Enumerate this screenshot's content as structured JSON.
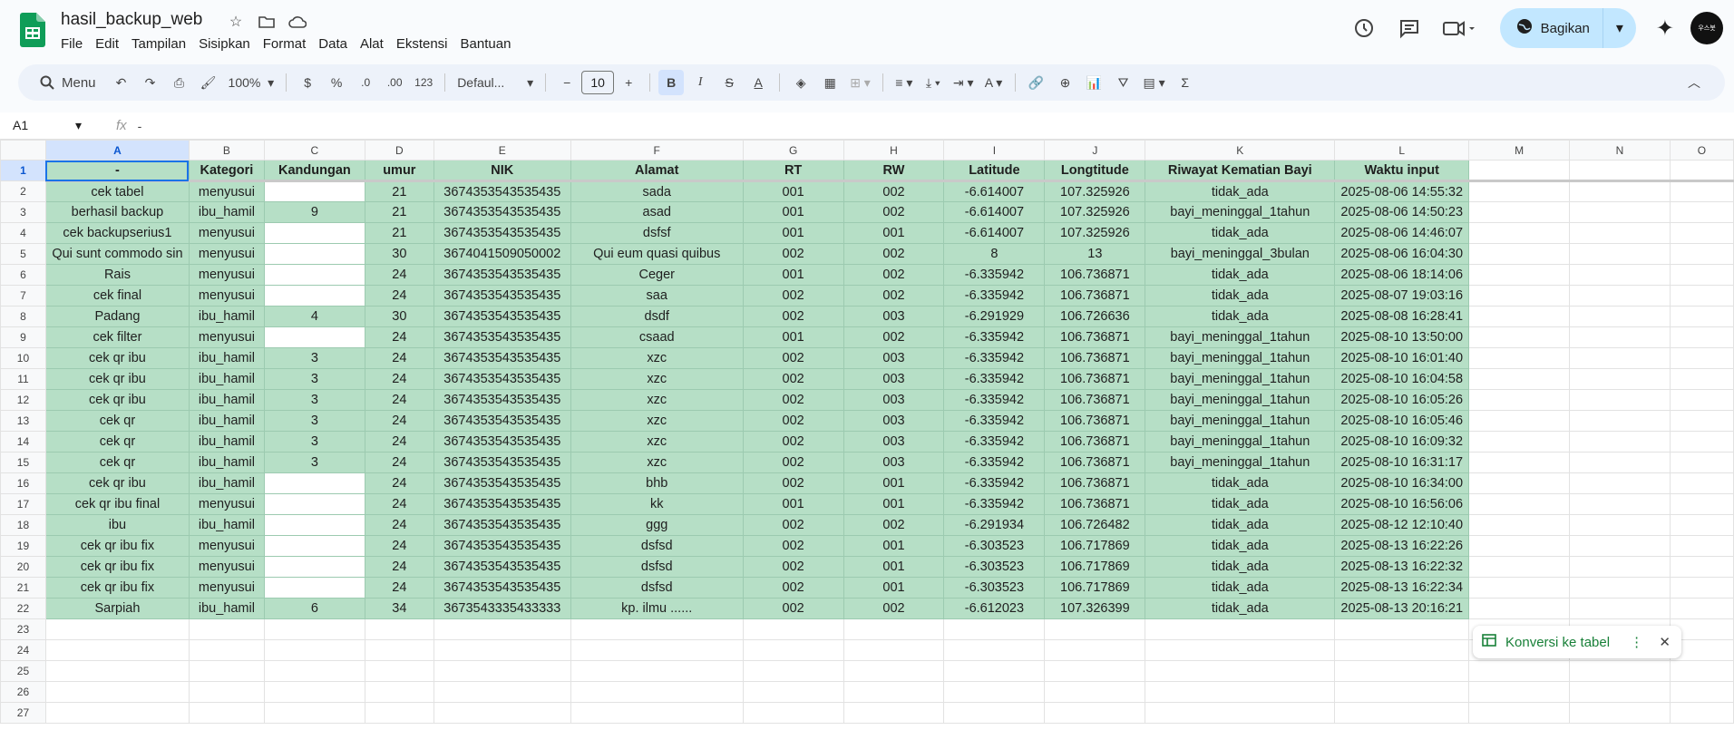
{
  "doc": {
    "title": "hasil_backup_web"
  },
  "menu": [
    "File",
    "Edit",
    "Tampilan",
    "Sisipkan",
    "Format",
    "Data",
    "Alat",
    "Ekstensi",
    "Bantuan"
  ],
  "share": {
    "label": "Bagikan"
  },
  "avatar": {
    "text": "우스봇"
  },
  "toolbar": {
    "menu_label": "Menu",
    "zoom": "100%",
    "currency": "$",
    "percent": "%",
    "dec_minus": ".0",
    "dec_plus": ".00",
    "num_format": "123",
    "font": "Defaul...",
    "font_size": "10"
  },
  "formula": {
    "cell_ref": "A1",
    "value": "-"
  },
  "columns": [
    "A",
    "B",
    "C",
    "D",
    "E",
    "F",
    "G",
    "H",
    "I",
    "J",
    "K",
    "L",
    "M",
    "N",
    "O"
  ],
  "header_row": [
    "-",
    "Kategori",
    "Kandungan",
    "umur",
    "NIK",
    "Alamat",
    "RT",
    "RW",
    "Latitude",
    "Longtitude",
    "Riwayat Kematian Bayi",
    "Waktu input"
  ],
  "rows": [
    [
      "cek tabel",
      "menyusui",
      "",
      "21",
      "3674353543535435",
      "sada",
      "001",
      "002",
      "-6.614007",
      "107.325926",
      "tidak_ada",
      "2025-08-06 14:55:32"
    ],
    [
      "berhasil backup",
      "ibu_hamil",
      "9",
      "21",
      "3674353543535435",
      "asad",
      "001",
      "002",
      "-6.614007",
      "107.325926",
      "bayi_meninggal_1tahun",
      "2025-08-06 14:50:23"
    ],
    [
      "cek backupserius1",
      "menyusui",
      "",
      "21",
      "3674353543535435",
      "dsfsf",
      "001",
      "001",
      "-6.614007",
      "107.325926",
      "tidak_ada",
      "2025-08-06 14:46:07"
    ],
    [
      "Qui sunt commodo sin",
      "menyusui",
      "",
      "30",
      "3674041509050002",
      "Qui eum quasi quibus",
      "002",
      "002",
      "8",
      "13",
      "bayi_meninggal_3bulan",
      "2025-08-06 16:04:30"
    ],
    [
      "Rais",
      "menyusui",
      "",
      "24",
      "3674353543535435",
      "Ceger",
      "001",
      "002",
      "-6.335942",
      "106.736871",
      "tidak_ada",
      "2025-08-06 18:14:06"
    ],
    [
      "cek final",
      "menyusui",
      "",
      "24",
      "3674353543535435",
      "saa",
      "002",
      "002",
      "-6.335942",
      "106.736871",
      "tidak_ada",
      "2025-08-07 19:03:16"
    ],
    [
      "Padang",
      "ibu_hamil",
      "4",
      "30",
      "3674353543535435",
      "dsdf",
      "002",
      "003",
      "-6.291929",
      "106.726636",
      "tidak_ada",
      "2025-08-08 16:28:41"
    ],
    [
      "cek filter",
      "menyusui",
      "",
      "24",
      "3674353543535435",
      "csaad",
      "001",
      "002",
      "-6.335942",
      "106.736871",
      "bayi_meninggal_1tahun",
      "2025-08-10 13:50:00"
    ],
    [
      "cek qr ibu",
      "ibu_hamil",
      "3",
      "24",
      "3674353543535435",
      "xzc",
      "002",
      "003",
      "-6.335942",
      "106.736871",
      "bayi_meninggal_1tahun",
      "2025-08-10 16:01:40"
    ],
    [
      "cek qr ibu",
      "ibu_hamil",
      "3",
      "24",
      "3674353543535435",
      "xzc",
      "002",
      "003",
      "-6.335942",
      "106.736871",
      "bayi_meninggal_1tahun",
      "2025-08-10 16:04:58"
    ],
    [
      "cek qr ibu",
      "ibu_hamil",
      "3",
      "24",
      "3674353543535435",
      "xzc",
      "002",
      "003",
      "-6.335942",
      "106.736871",
      "bayi_meninggal_1tahun",
      "2025-08-10 16:05:26"
    ],
    [
      "cek qr",
      "ibu_hamil",
      "3",
      "24",
      "3674353543535435",
      "xzc",
      "002",
      "003",
      "-6.335942",
      "106.736871",
      "bayi_meninggal_1tahun",
      "2025-08-10 16:05:46"
    ],
    [
      "cek qr",
      "ibu_hamil",
      "3",
      "24",
      "3674353543535435",
      "xzc",
      "002",
      "003",
      "-6.335942",
      "106.736871",
      "bayi_meninggal_1tahun",
      "2025-08-10 16:09:32"
    ],
    [
      "cek qr",
      "ibu_hamil",
      "3",
      "24",
      "3674353543535435",
      "xzc",
      "002",
      "003",
      "-6.335942",
      "106.736871",
      "bayi_meninggal_1tahun",
      "2025-08-10 16:31:17"
    ],
    [
      "cek qr ibu",
      "ibu_hamil",
      "",
      "24",
      "3674353543535435",
      "bhb",
      "002",
      "001",
      "-6.335942",
      "106.736871",
      "tidak_ada",
      "2025-08-10 16:34:00"
    ],
    [
      "cek qr ibu final",
      "menyusui",
      "",
      "24",
      "3674353543535435",
      "kk",
      "001",
      "001",
      "-6.335942",
      "106.736871",
      "tidak_ada",
      "2025-08-10 16:56:06"
    ],
    [
      "ibu",
      "ibu_hamil",
      "",
      "24",
      "3674353543535435",
      "ggg",
      "002",
      "002",
      "-6.291934",
      "106.726482",
      "tidak_ada",
      "2025-08-12 12:10:40"
    ],
    [
      "cek qr ibu fix",
      "menyusui",
      "",
      "24",
      "3674353543535435",
      "dsfsd",
      "002",
      "001",
      "-6.303523",
      "106.717869",
      "tidak_ada",
      "2025-08-13 16:22:26"
    ],
    [
      "cek qr ibu fix",
      "menyusui",
      "",
      "24",
      "3674353543535435",
      "dsfsd",
      "002",
      "001",
      "-6.303523",
      "106.717869",
      "tidak_ada",
      "2025-08-13 16:22:32"
    ],
    [
      "cek qr ibu fix",
      "menyusui",
      "",
      "24",
      "3674353543535435",
      "dsfsd",
      "002",
      "001",
      "-6.303523",
      "106.717869",
      "tidak_ada",
      "2025-08-13 16:22:34"
    ],
    [
      "Sarpiah",
      "ibu_hamil",
      "6",
      "34",
      "3673543335433333",
      "kp. ilmu ......",
      "002",
      "002",
      "-6.612023",
      "107.326399",
      "tidak_ada",
      "2025-08-13 20:16:21"
    ]
  ],
  "empty_row_numbers": [
    "23",
    "24",
    "25",
    "26",
    "27"
  ],
  "toast": {
    "label": "Konversi ke tabel"
  },
  "colors": {
    "accent": "#0b57d0",
    "table_fill": "#b6dfc6",
    "share_bg": "#c2e7ff"
  }
}
